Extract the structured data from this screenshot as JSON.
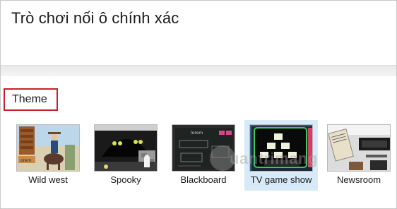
{
  "page": {
    "title": "Trò chơi nối ô chính xác"
  },
  "theme_section": {
    "label": "Theme",
    "items": [
      {
        "name": "Wild west",
        "selected": false
      },
      {
        "name": "Spooky",
        "selected": false
      },
      {
        "name": "Blackboard",
        "selected": false
      },
      {
        "name": "TV game show",
        "selected": true
      },
      {
        "name": "Newsroom",
        "selected": false
      }
    ]
  },
  "watermark": {
    "text": "uantrimang"
  }
}
